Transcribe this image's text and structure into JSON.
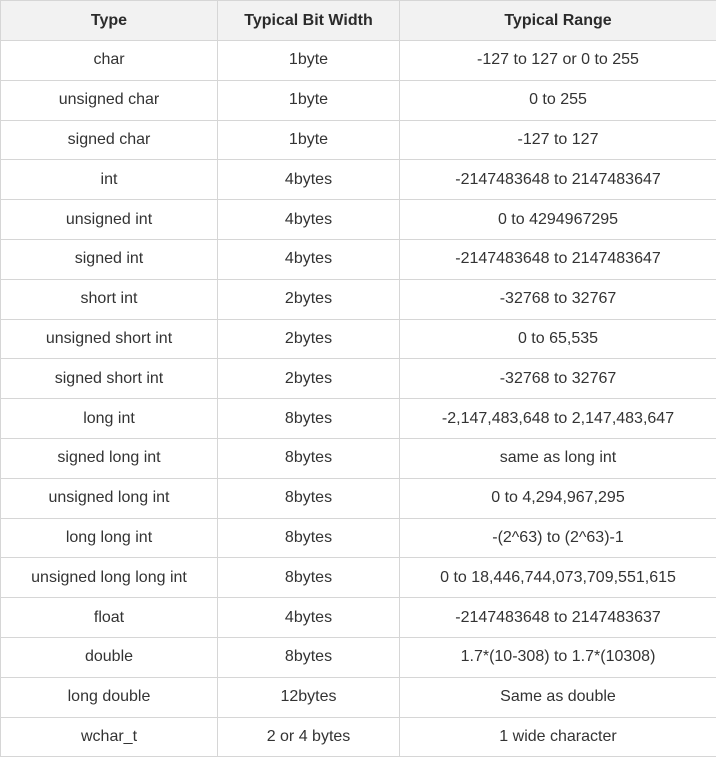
{
  "table": {
    "headers": [
      "Type",
      "Typical Bit Width",
      "Typical Range"
    ],
    "rows": [
      [
        "char",
        "1byte",
        "-127 to 127 or 0 to 255"
      ],
      [
        "unsigned char",
        "1byte",
        "0 to 255"
      ],
      [
        "signed char",
        "1byte",
        "-127 to 127"
      ],
      [
        "int",
        "4bytes",
        "-2147483648 to 2147483647"
      ],
      [
        "unsigned int",
        "4bytes",
        "0 to 4294967295"
      ],
      [
        "signed int",
        "4bytes",
        "-2147483648 to 2147483647"
      ],
      [
        "short int",
        "2bytes",
        "-32768 to 32767"
      ],
      [
        "unsigned short int",
        "2bytes",
        "0 to 65,535"
      ],
      [
        "signed short int",
        "2bytes",
        "-32768 to 32767"
      ],
      [
        "long int",
        "8bytes",
        "-2,147,483,648 to 2,147,483,647"
      ],
      [
        "signed long int",
        "8bytes",
        "same as long int"
      ],
      [
        "unsigned long int",
        "8bytes",
        "0 to 4,294,967,295"
      ],
      [
        "long long int",
        "8bytes",
        "-(2^63) to (2^63)-1"
      ],
      [
        "unsigned long long int",
        "8bytes",
        "0 to 18,446,744,073,709,551,615"
      ],
      [
        "float",
        "4bytes",
        "-2147483648 to 2147483637"
      ],
      [
        "double",
        "8bytes",
        "1.7*(10-308) to 1.7*(10308)"
      ],
      [
        "long double",
        "12bytes",
        "Same as double"
      ],
      [
        "wchar_t",
        "2 or 4 bytes",
        "1 wide character"
      ]
    ]
  },
  "colors": {
    "header_bg": "#f2f2f2",
    "border": "#d6d6d6",
    "text": "#333333"
  }
}
